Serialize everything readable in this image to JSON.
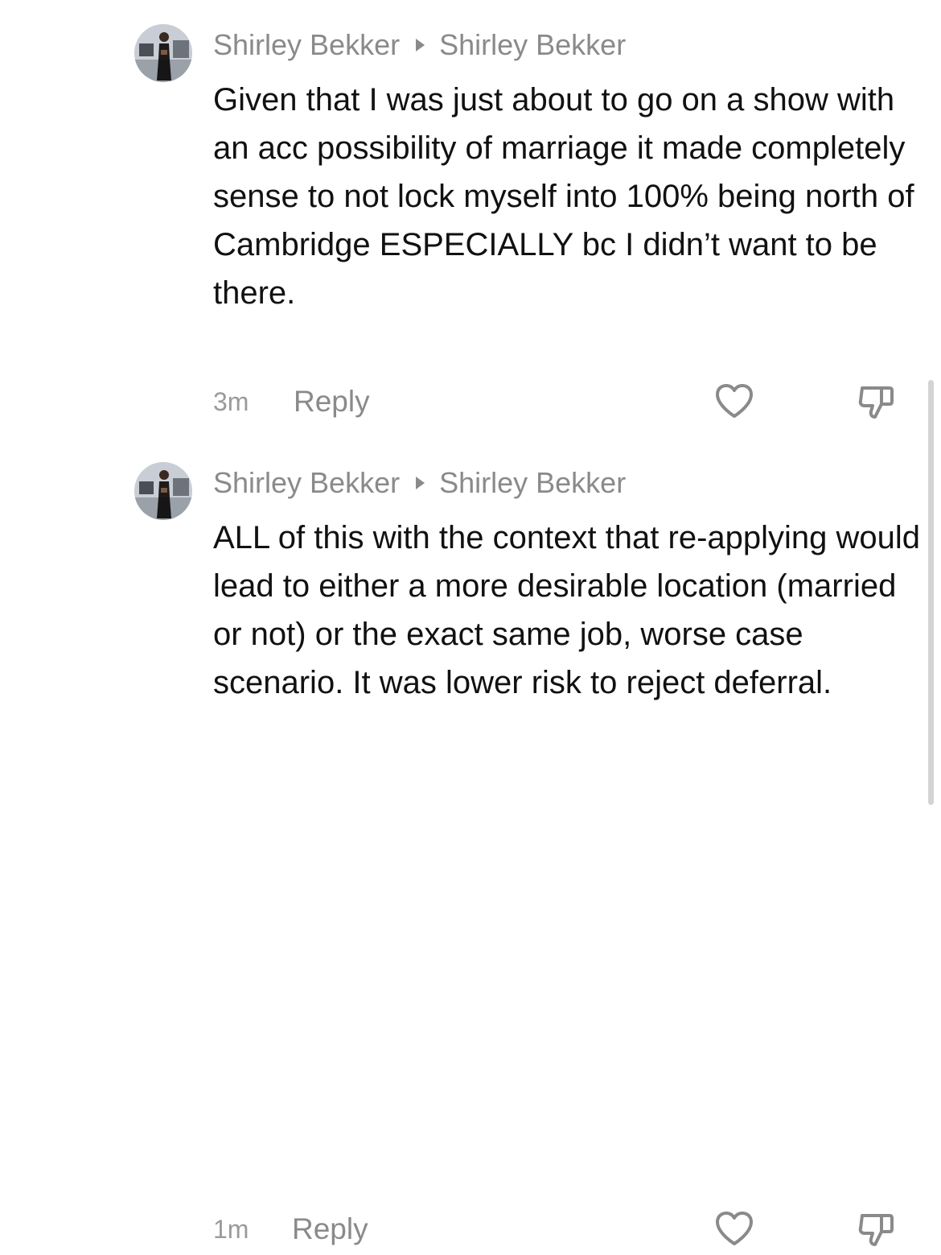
{
  "comments": [
    {
      "author": "Shirley Bekker",
      "reply_to": "Shirley Bekker",
      "text": "Given that I was just about to go on a show with an acc possibility of marriage it made completely sense to not lock myself into 100% being north of Cambridge ESPECIALLY bc I didn’t want to be there.",
      "time": "3m",
      "reply_label": "Reply"
    },
    {
      "author": "Shirley Bekker",
      "reply_to": "Shirley Bekker",
      "text": "ALL of this with the context that re-applying would lead to either a more desirable location (married or not) or the exact same job, worse case scenario. It was lower risk to reject deferral.",
      "time": "1m",
      "reply_label": "Reply"
    }
  ],
  "icons": {
    "like": "heart-outline-icon",
    "dislike": "thumbs-down-outline-icon",
    "reply_arrow": "triangle-right-icon"
  },
  "colors": {
    "text": "#111111",
    "secondary_text": "#8a8a8a",
    "background": "#ffffff"
  }
}
